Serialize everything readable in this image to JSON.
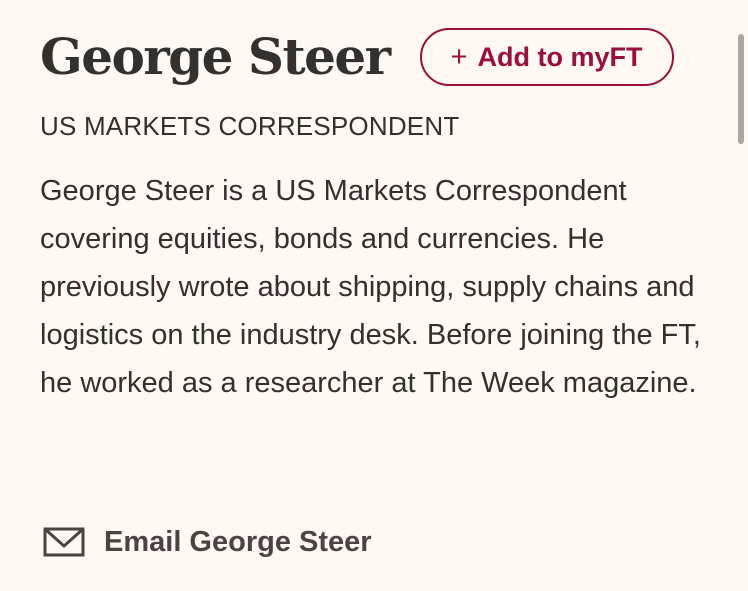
{
  "author": {
    "name": "George Steer",
    "role": "US MARKETS CORRESPONDENT",
    "bio": "George Steer is a US Markets Correspondent covering equities, bonds and currencies. He previously wrote about shipping, supply chains and logistics on the industry desk. Before joining the FT, he worked as a researcher at The Week magazine."
  },
  "myft_button": {
    "icon": "plus-icon",
    "symbol": "+",
    "label": "Add to myFT"
  },
  "email": {
    "icon": "mail-icon",
    "label": "Email George Steer"
  },
  "colors": {
    "background": "#FFF8F3",
    "text": "#33302E",
    "accent": "#990F3D"
  }
}
